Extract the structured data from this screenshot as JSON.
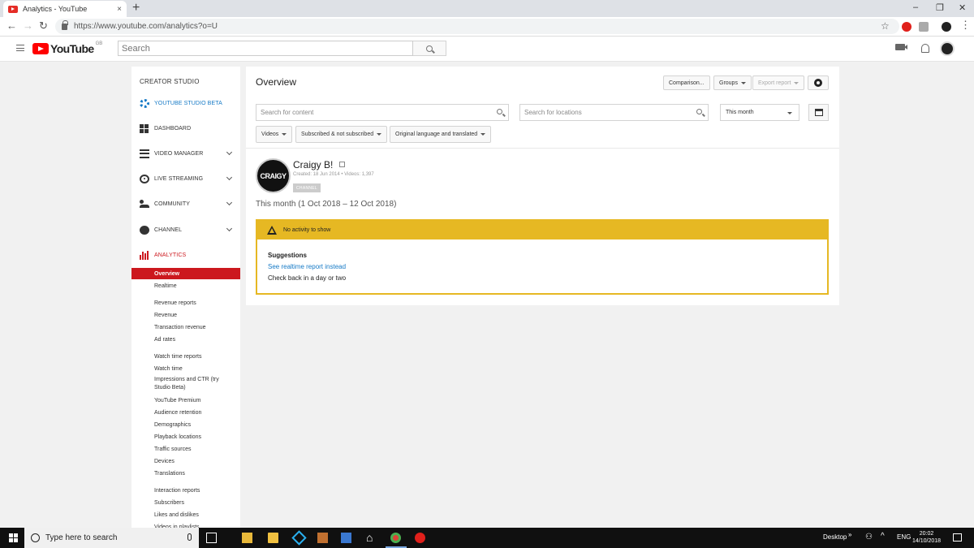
{
  "browser": {
    "tab_title": "Analytics - YouTube",
    "tab_close": "×",
    "new_tab": "+",
    "url": "https://www.youtube.com/analytics?o=U",
    "star": "☆"
  },
  "masthead": {
    "logo_word": "YouTube",
    "region": "GB",
    "search_placeholder": "Search"
  },
  "sidebar": {
    "header": "CREATOR STUDIO",
    "items": [
      {
        "label": "YOUTUBE STUDIO BETA",
        "color": "#167ac6"
      },
      {
        "label": "DASHBOARD"
      },
      {
        "label": "VIDEO MANAGER"
      },
      {
        "label": "LIVE STREAMING"
      },
      {
        "label": "COMMUNITY"
      },
      {
        "label": "CHANNEL"
      },
      {
        "label": "ANALYTICS",
        "color": "#cc181e"
      }
    ],
    "analytics_sub": [
      "Overview",
      "Realtime",
      "Revenue reports",
      "Revenue",
      "Transaction revenue",
      "Ad rates",
      "Watch time reports",
      "Watch time",
      "Impressions and CTR (try Studio Beta)",
      "YouTube Premium",
      "Audience retention",
      "Demographics",
      "Playback locations",
      "Traffic sources",
      "Devices",
      "Translations",
      "Interaction reports",
      "Subscribers",
      "Likes and dislikes",
      "Videos in playlists"
    ]
  },
  "main": {
    "title": "Overview",
    "buttons": {
      "comparison": "Comparison...",
      "groups": "Groups",
      "export": "Export report"
    },
    "search_content_placeholder": "Search for content",
    "search_locations_placeholder": "Search for locations",
    "date_select": "This month",
    "filters": [
      "Videos",
      "Subscribed & not subscribed",
      "Original language and translated"
    ],
    "channel": {
      "avatar_text": "CRAIGY",
      "name": "Craigy B!",
      "meta": "Created: 18 Jun 2014  •  Videos: 1,397",
      "badge": "CHANNEL"
    },
    "period": "This month (1 Oct 2018 – 12 Oct 2018)",
    "alert": {
      "title": "No activity to show",
      "suggestions": "Suggestions",
      "link": "See realtime report instead",
      "text": "Check back in a day or two",
      "color": "#e6b823"
    }
  },
  "taskbar": {
    "search": "Type here to search",
    "desktop": "Desktop",
    "chevrons": "»",
    "lang": "ENG",
    "time": "20:02",
    "date": "14/10/2018"
  },
  "colors": {
    "brand_red": "#ff0000",
    "active_nav": "#cc181e",
    "link_blue": "#167ac6"
  }
}
